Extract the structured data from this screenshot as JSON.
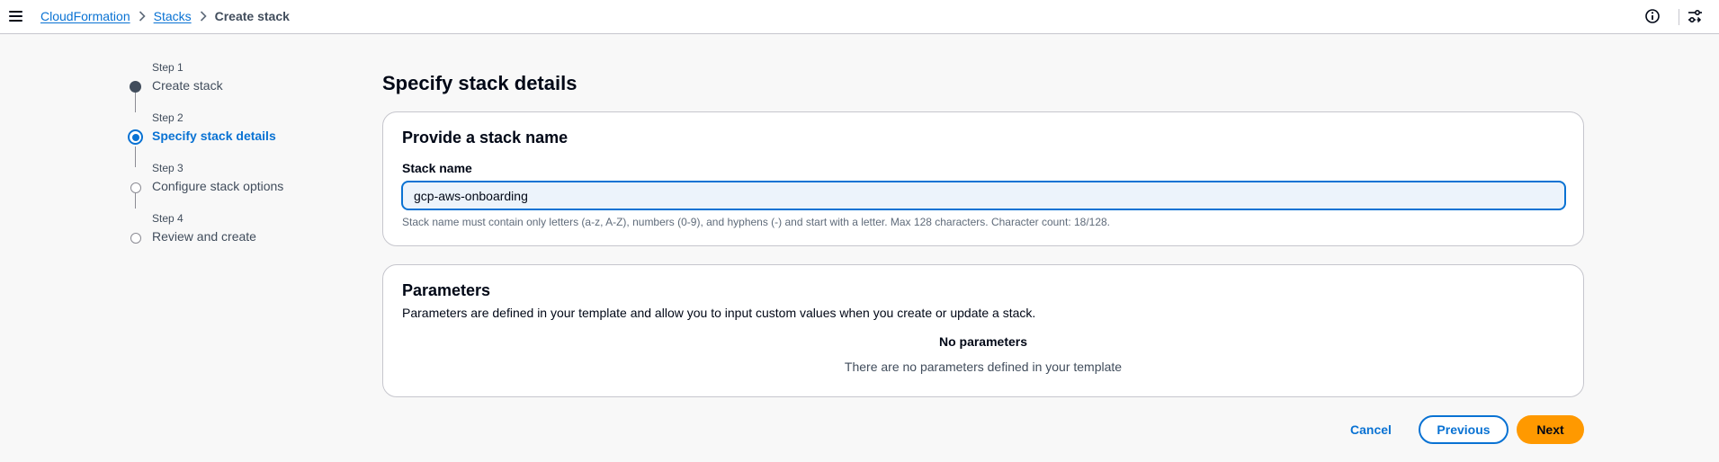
{
  "breadcrumb": {
    "items": [
      {
        "label": "CloudFormation"
      },
      {
        "label": "Stacks"
      }
    ],
    "current": "Create stack"
  },
  "icons": {
    "menu": "hamburger-menu-icon",
    "separator": "chevron-right-icon",
    "info": "info-icon",
    "settings": "settings-sliders-icon"
  },
  "stepper": {
    "steps": [
      {
        "number": "Step 1",
        "title": "Create stack",
        "state": "completed"
      },
      {
        "number": "Step 2",
        "title": "Specify stack details",
        "state": "current"
      },
      {
        "number": "Step 3",
        "title": "Configure stack options",
        "state": "upcoming"
      },
      {
        "number": "Step 4",
        "title": "Review and create",
        "state": "upcoming"
      }
    ]
  },
  "page": {
    "title": "Specify stack details"
  },
  "stack_name_panel": {
    "heading": "Provide a stack name",
    "field_label": "Stack name",
    "value": "gcp-aws-onboarding",
    "hint": "Stack name must contain only letters (a-z, A-Z), numbers (0-9), and hyphens (-) and start with a letter. Max 128 characters. Character count: 18/128."
  },
  "parameters_panel": {
    "heading": "Parameters",
    "description": "Parameters are defined in your template and allow you to input custom values when you create or update a stack.",
    "empty_title": "No parameters",
    "empty_text": "There are no parameters defined in your template"
  },
  "actions": {
    "cancel": "Cancel",
    "previous": "Previous",
    "next": "Next"
  },
  "colors": {
    "link": "#0972d3",
    "primary_button": "#ff9900",
    "text": "#000716",
    "border": "#c6c6cd",
    "background": "#f8f8f8"
  }
}
